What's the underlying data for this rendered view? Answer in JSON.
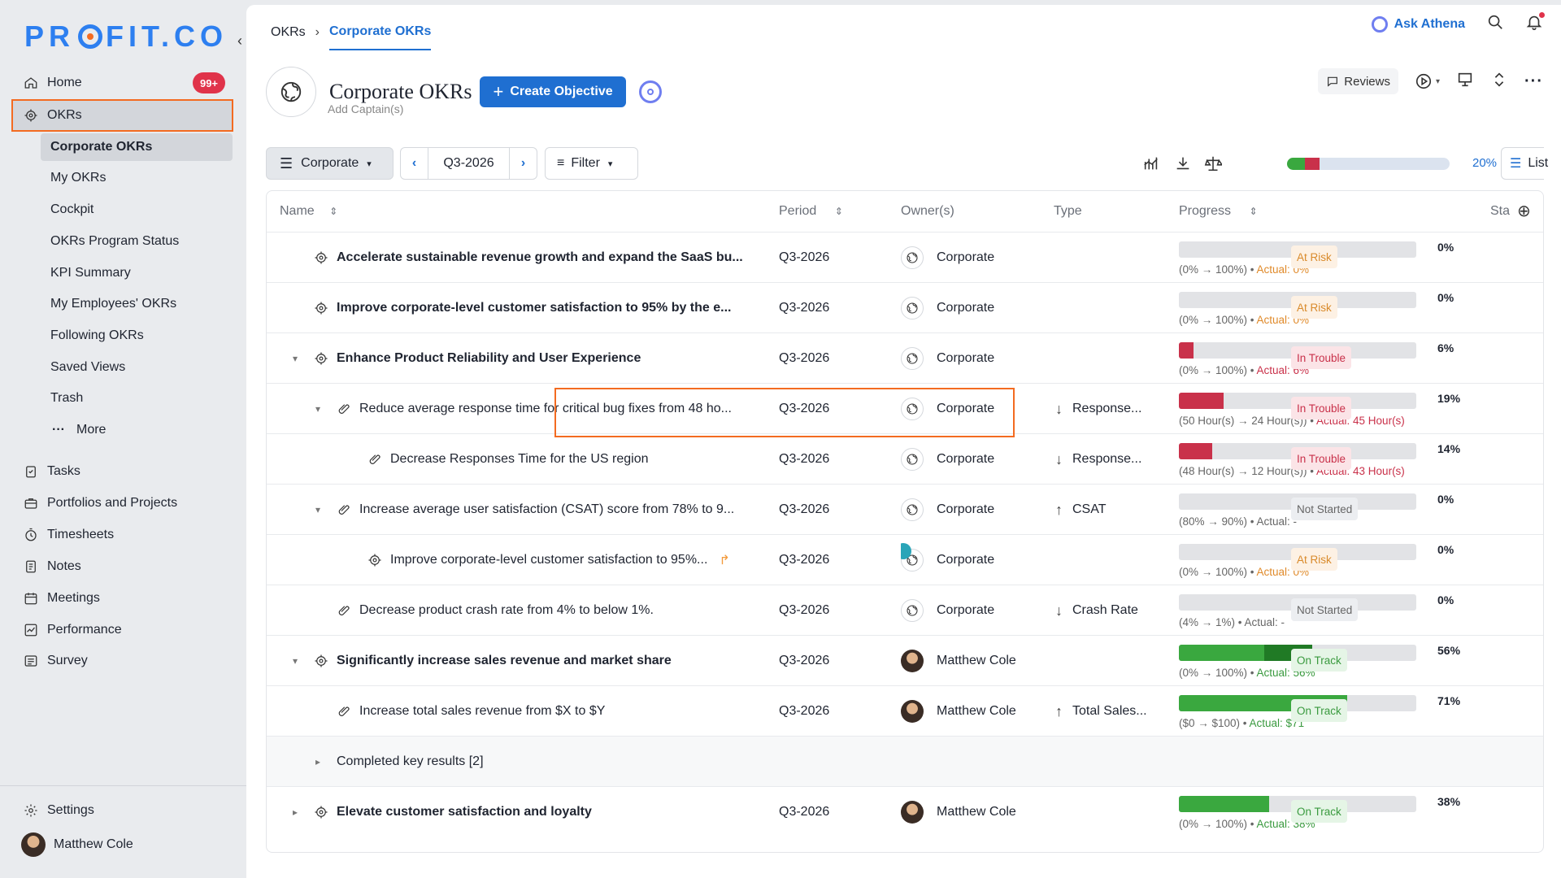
{
  "sidebar": {
    "logo_text": "PR  FIT.CO",
    "logo_left": "PR",
    "logo_right": "FIT.CO",
    "home_label": "Home",
    "home_badge": "99+",
    "okrs_label": "OKRs",
    "okr_sub": [
      "Corporate OKRs",
      "My OKRs",
      "Cockpit",
      "OKRs Program Status",
      "KPI Summary",
      "My Employees' OKRs",
      "Following OKRs",
      "Saved Views",
      "Trash"
    ],
    "more_label": "More",
    "nav": [
      "Tasks",
      "Portfolios and Projects",
      "Timesheets",
      "Notes",
      "Meetings",
      "Performance",
      "Survey"
    ],
    "settings_label": "Settings",
    "user_name": "Matthew Cole"
  },
  "header": {
    "crumb_root": "OKRs",
    "crumb_current": "Corporate OKRs",
    "ask_label": "Ask Athena"
  },
  "page": {
    "title": "Corporate OKRs",
    "add_captain": "Add Captain(s)",
    "create_label": "Create Objective",
    "reviews_label": "Reviews"
  },
  "toolbar": {
    "scope_label": "Corporate",
    "period_label": "Q3-2026",
    "filter_label": "Filter",
    "overall_pct": "20%",
    "view_label": "List"
  },
  "columns": {
    "name": "Name",
    "period": "Period",
    "owner": "Owner(s)",
    "type": "Type",
    "progress": "Progress",
    "status": "Sta"
  },
  "rows": [
    {
      "name": "Accelerate sustainable revenue growth and expand the SaaS bu...",
      "period": "Q3-2026",
      "owner": "Corporate",
      "type": "",
      "pct": "0%",
      "fill": 0,
      "range": "(0% → 100%) • ",
      "actual": "Actual: 0%",
      "status": "At Risk"
    },
    {
      "name": "Improve corporate-level customer satisfaction to 95% by the e...",
      "period": "Q3-2026",
      "owner": "Corporate",
      "type": "",
      "pct": "0%",
      "fill": 0,
      "range": "(0% → 100%) • ",
      "actual": "Actual: 0%",
      "status": "At Risk"
    },
    {
      "name": "Enhance Product Reliability and User Experience",
      "period": "Q3-2026",
      "owner": "Corporate",
      "type": "",
      "pct": "6%",
      "fill": 6,
      "range": "(0% → 100%) • ",
      "actual": "Actual: 6%",
      "status": "In Trouble"
    },
    {
      "name": "Reduce average response time for critical bug fixes from 48 ho...",
      "period": "Q3-2026",
      "owner": "Corporate",
      "type": "Response...",
      "pct": "19%",
      "fill": 19,
      "range": "(50 Hour(s)  →  24 Hour(s)) • ",
      "actual": "Actual: 45 Hour(s)",
      "status": "In Trouble"
    },
    {
      "name": "Decrease Responses Time for the US region",
      "period": "Q3-2026",
      "owner": "Corporate",
      "type": "Response...",
      "pct": "14%",
      "fill": 14,
      "range": "(48 Hour(s)  →  12 Hour(s)) • ",
      "actual": "Actual: 43 Hour(s)",
      "status": "In Trouble"
    },
    {
      "name": "Increase average user satisfaction (CSAT) score from 78% to 9...",
      "period": "Q3-2026",
      "owner": "Corporate",
      "type": "CSAT",
      "pct": "0%",
      "fill": 0,
      "range": "(80%  →  90%) • ",
      "actual": "Actual: -",
      "status": "Not Started"
    },
    {
      "name": "Improve corporate-level customer satisfaction to 95%...",
      "period": "Q3-2026",
      "owner": "Corporate",
      "type": "",
      "pct": "0%",
      "fill": 0,
      "range": "(0% → 100%) • ",
      "actual": "Actual: 0%",
      "status": "At Risk"
    },
    {
      "name": "Decrease product crash rate from 4% to below 1%.",
      "period": "Q3-2026",
      "owner": "Corporate",
      "type": "Crash Rate",
      "pct": "0%",
      "fill": 0,
      "range": "(4%  →  1%) • ",
      "actual": "Actual: -",
      "status": "Not Started"
    },
    {
      "name": "Significantly increase sales revenue and market share",
      "period": "Q3-2026",
      "owner": "Matthew Cole",
      "type": "",
      "pct": "56%",
      "fill": 56,
      "range": "(0% → 100%) • ",
      "actual": "Actual: 56%",
      "status": "On Track"
    },
    {
      "name": "Increase total sales revenue from $X to $Y",
      "period": "Q3-2026",
      "owner": "Matthew Cole",
      "type": "Total Sales...",
      "pct": "71%",
      "fill": 71,
      "range": "($0  →  $100) • ",
      "actual": "Actual: $71",
      "status": "On Track"
    },
    {
      "name": "Completed key results [2]"
    },
    {
      "name": "Elevate customer satisfaction and loyalty",
      "period": "Q3-2026",
      "owner": "Matthew Cole",
      "type": "",
      "pct": "38%",
      "fill": 38,
      "range": "(0% → 100%) • ",
      "actual": "Actual: 38%",
      "status": "On Track"
    }
  ],
  "colors": {
    "accent": "#1f6fd1",
    "red": "#c9314a",
    "green": "#3aa83f",
    "orange": "#f36b21"
  }
}
